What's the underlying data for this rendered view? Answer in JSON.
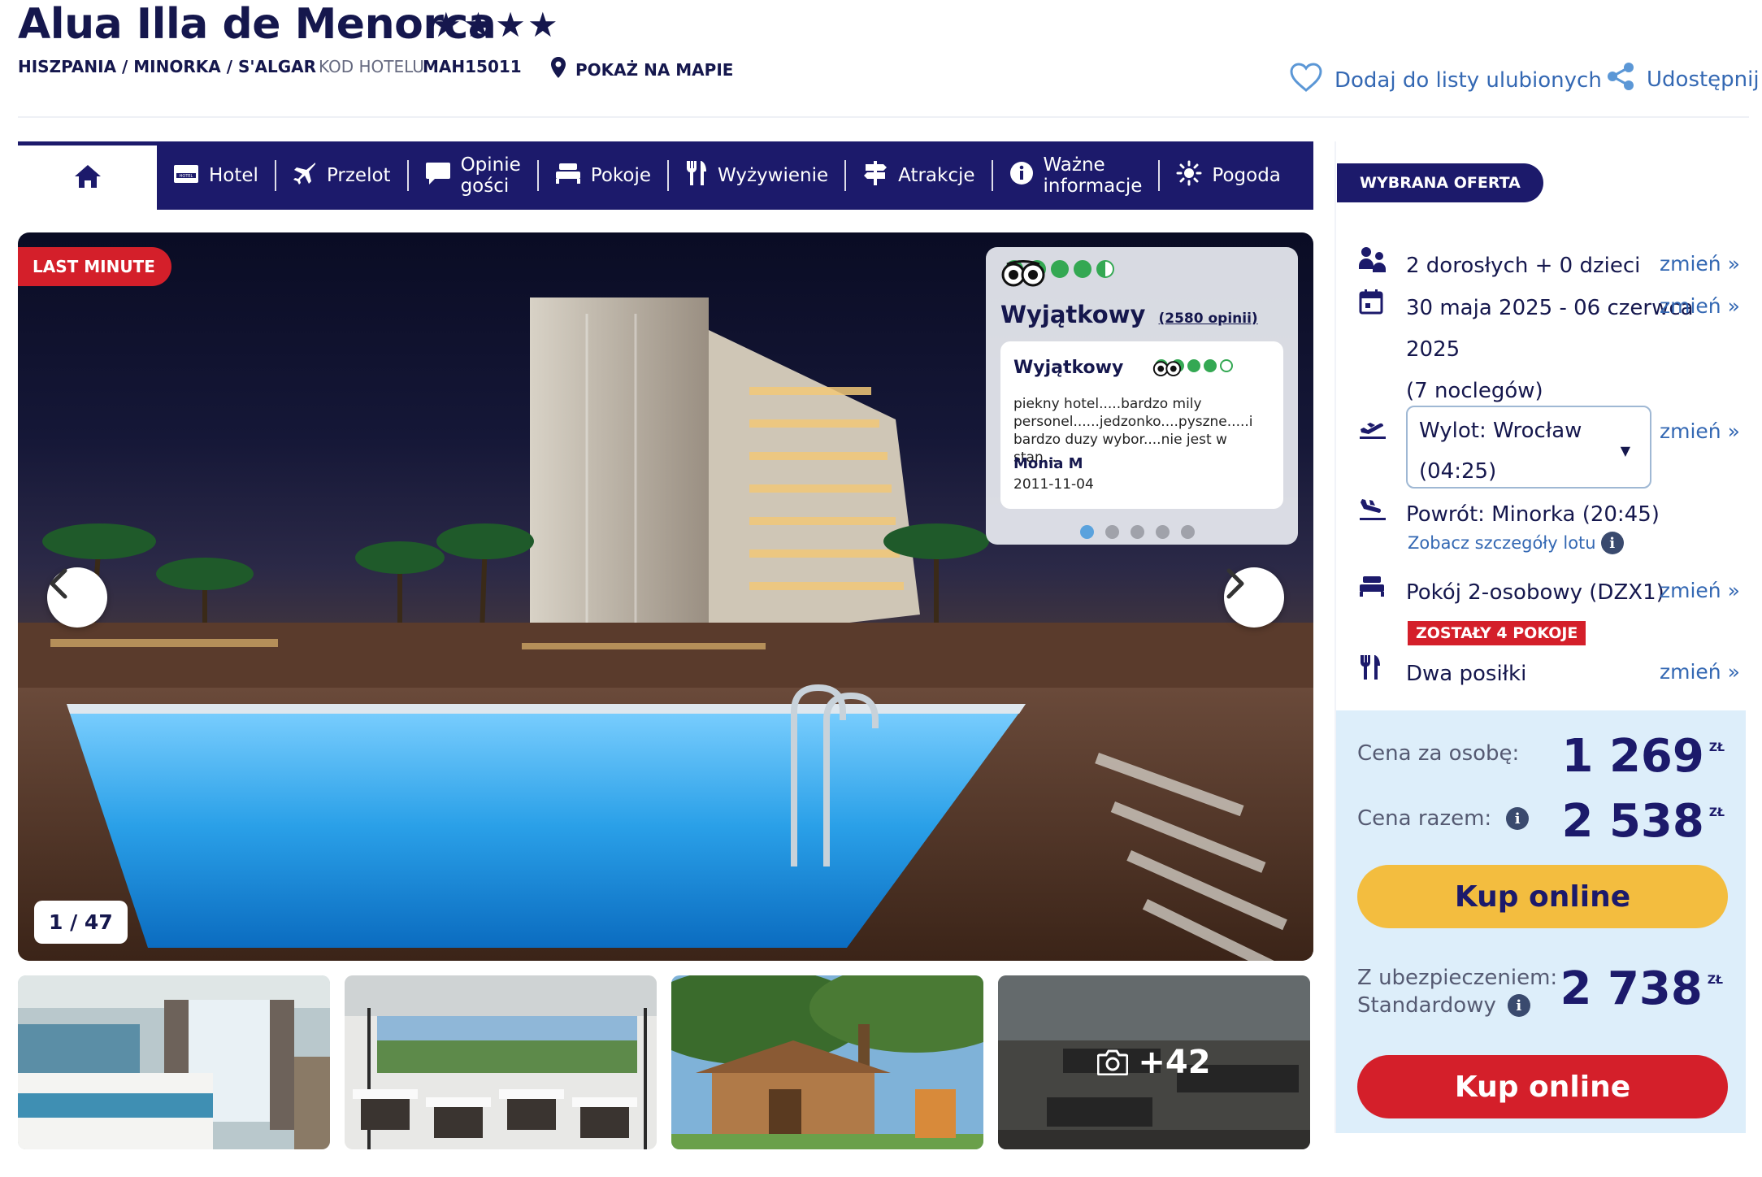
{
  "header": {
    "title": "Alua Illa de Menorca",
    "stars": "★★★★",
    "breadcrumb": "HISZPANIA / MINORKA / S'ALGAR",
    "hotel_code_label": "KOD HOTELU",
    "hotel_code": "MAH15011",
    "map_link": "POKAŻ NA MAPIE",
    "favorites": "Dodaj do listy ulubionych",
    "share": "Udostępnij"
  },
  "tabs": [
    {
      "label": "",
      "icon": "home-icon"
    },
    {
      "label": "Hotel",
      "icon": "hotel-icon"
    },
    {
      "label": "Przelot",
      "icon": "plane-icon"
    },
    {
      "label": "Opinie gości",
      "icon": "chat-icon"
    },
    {
      "label": "Pokoje",
      "icon": "bed-icon"
    },
    {
      "label": "Wyżywienie",
      "icon": "cutlery-icon"
    },
    {
      "label": "Atrakcje",
      "icon": "signpost-icon"
    },
    {
      "label": "Ważne informacje",
      "icon": "info-icon"
    },
    {
      "label": "Pogoda",
      "icon": "sun-icon"
    }
  ],
  "gallery": {
    "badge": "LAST MINUTE",
    "counter": "1 / 47",
    "more_count": "+42"
  },
  "tripadvisor": {
    "rating_word": "Wyjątkowy",
    "rating_count": "(2580 opinii)",
    "rating": 4.5,
    "review": {
      "title": "Wyjątkowy",
      "text": "piekny hotel.....bardzo mily personel......jedzonko....pyszne.....i bardzo duzy wybor....nie jest w stan...",
      "author": "Monia M",
      "date": "2011-11-04",
      "rating": 4
    }
  },
  "offer": {
    "pill": "WYBRANA OFERTA",
    "guests": "2 dorosłych + 0 dzieci",
    "dates_line1": "30 maja 2025 - 06 czerwca",
    "dates_line2": "2025",
    "nights": "(7 noclegów)",
    "departure_line1": "Wylot: Wrocław",
    "departure_line2": "(04:25)",
    "return": "Powrót: Minorka (20:45)",
    "flight_details": "Zobacz szczegóły lotu",
    "room": "Pokój 2-osobowy (DZX1)",
    "rooms_left": "ZOSTAŁY 4 POKOJE",
    "board": "Dwa posiłki",
    "change": "zmień »"
  },
  "prices": {
    "per_person_label": "Cena za osobę:",
    "per_person": "1 269",
    "total_label": "Cena razem:",
    "total": "2 538",
    "currency": "ZŁ",
    "buy_online": "Kup online",
    "insurance_label_1": "Z ubezpieczeniem:",
    "insurance_label_2": "Standardowy",
    "with_insurance": "2 738",
    "buy_online_2": "Kup online"
  },
  "colors": {
    "navy": "#1c1a6b",
    "link_blue": "#3468b3",
    "red": "#d41f2a",
    "yellow": "#f3bd3f",
    "panel_blue": "#ddeefa",
    "tripadvisor_green": "#34a853"
  }
}
